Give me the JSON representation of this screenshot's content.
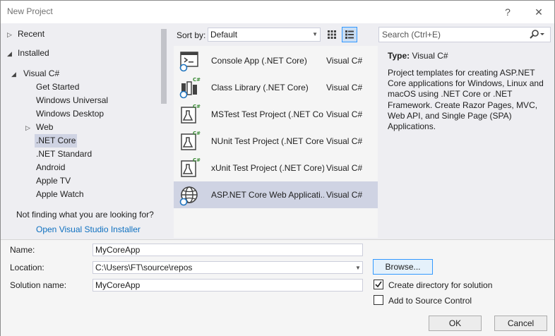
{
  "window": {
    "title": "New Project",
    "help_glyph": "?",
    "close_glyph": "✕"
  },
  "tree": {
    "items": [
      {
        "label": "Recent",
        "level": 0,
        "expander": "collapsed"
      },
      {
        "label": "Installed",
        "level": 0,
        "expander": "expanded"
      },
      {
        "label": "Visual C#",
        "level": 1,
        "expander": "expanded"
      },
      {
        "label": "Get Started",
        "level": 2
      },
      {
        "label": "Windows Universal",
        "level": 2
      },
      {
        "label": "Windows Desktop",
        "level": 2
      },
      {
        "label": "Web",
        "level": 2,
        "expander": "collapsed"
      },
      {
        "label": ".NET Core",
        "level": 2,
        "selected": true
      },
      {
        "label": ".NET Standard",
        "level": 2
      },
      {
        "label": "Android",
        "level": 2
      },
      {
        "label": "Apple TV",
        "level": 2
      },
      {
        "label": "Apple Watch",
        "level": 2
      }
    ],
    "not_finding": "Not finding what you are looking for?",
    "installer_link": "Open Visual Studio Installer"
  },
  "sort": {
    "label": "Sort by:",
    "value": "Default"
  },
  "search": {
    "placeholder": "Search (Ctrl+E)"
  },
  "templates": [
    {
      "name": "Console App (.NET Core)",
      "lang": "Visual C#",
      "icon": "console-app-icon"
    },
    {
      "name": "Class Library (.NET Core)",
      "lang": "Visual C#",
      "icon": "class-library-icon"
    },
    {
      "name": "MSTest Test Project (.NET Co...",
      "lang": "Visual C#",
      "icon": "test-project-icon"
    },
    {
      "name": "NUnit Test Project (.NET Core)",
      "lang": "Visual C#",
      "icon": "test-project-icon"
    },
    {
      "name": "xUnit Test Project (.NET Core)",
      "lang": "Visual C#",
      "icon": "test-project-icon"
    },
    {
      "name": "ASP.NET Core Web Applicati...",
      "lang": "Visual C#",
      "icon": "web-app-globe-icon",
      "selected": true
    }
  ],
  "details": {
    "type_label": "Type:",
    "type_value": "Visual C#",
    "description": "Project templates for creating ASP.NET Core applications for Windows, Linux and macOS using .NET Core or .NET Framework. Create Razor Pages, MVC, Web API, and Single Page (SPA) Applications."
  },
  "form": {
    "name_label": "Name:",
    "name_value": "MyCoreApp",
    "location_label": "Location:",
    "location_value": "C:\\Users\\FT\\source\\repos",
    "solution_label": "Solution name:",
    "solution_value": "MyCoreApp",
    "browse_label": "Browse...",
    "create_dir_label": "Create directory for solution",
    "create_dir_checked": true,
    "source_control_label": "Add to Source Control",
    "source_control_checked": false,
    "ok_label": "OK",
    "cancel_label": "Cancel"
  },
  "colors": {
    "accent": "#3399ff",
    "selection": "#cfd3e3",
    "link": "#0e70c0",
    "csharp_badge": "#388a34"
  }
}
